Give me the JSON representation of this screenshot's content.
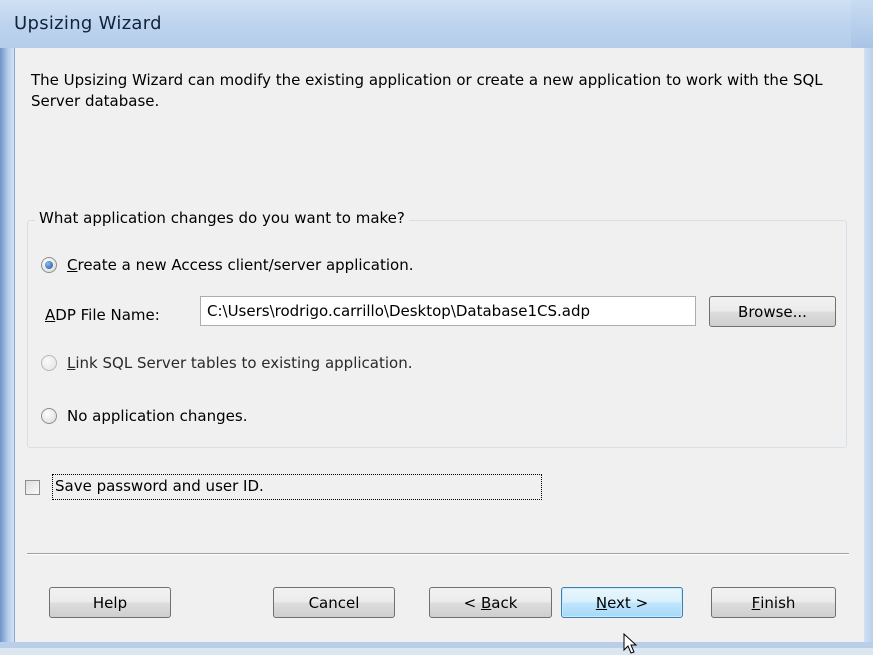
{
  "window": {
    "title": "Upsizing Wizard"
  },
  "intro_text": "The Upsizing Wizard can modify the existing application or create a new application to work with the SQL Server database.",
  "group": {
    "legend": "What application changes do you want to make?",
    "options": [
      {
        "label": "Create a new Access client/server application.",
        "mnemonic": "C",
        "rest": "reate a new Access client/server application.",
        "selected": true,
        "enabled": true
      },
      {
        "label": "Link SQL Server tables to existing application.",
        "mnemonic": "L",
        "rest": "ink SQL Server tables to existing application.",
        "selected": false,
        "enabled": false
      },
      {
        "label": "No application changes.",
        "mnemonic": "",
        "rest": "No application changes.",
        "selected": false,
        "enabled": true
      }
    ],
    "adp": {
      "label_mnemonic": "A",
      "label_rest": "DP File Name:",
      "value": "C:\\Users\\rodrigo.carrillo\\Desktop\\Database1CS.adp"
    },
    "browse_label": "Browse..."
  },
  "save_password": {
    "label": "Save password and user ID.",
    "checked": false
  },
  "buttons": {
    "help": "Help",
    "cancel": "Cancel",
    "back_prefix": "< ",
    "back_mnemonic": "B",
    "back_rest": "ack",
    "next_mnemonic": "N",
    "next_rest": "ext >",
    "finish_mnemonic": "F",
    "finish_rest": "inish"
  },
  "colors": {
    "title_bar": "#bcd3ee",
    "dialog_bg": "#f0f0f0",
    "default_button_border": "#3c7fb1"
  }
}
